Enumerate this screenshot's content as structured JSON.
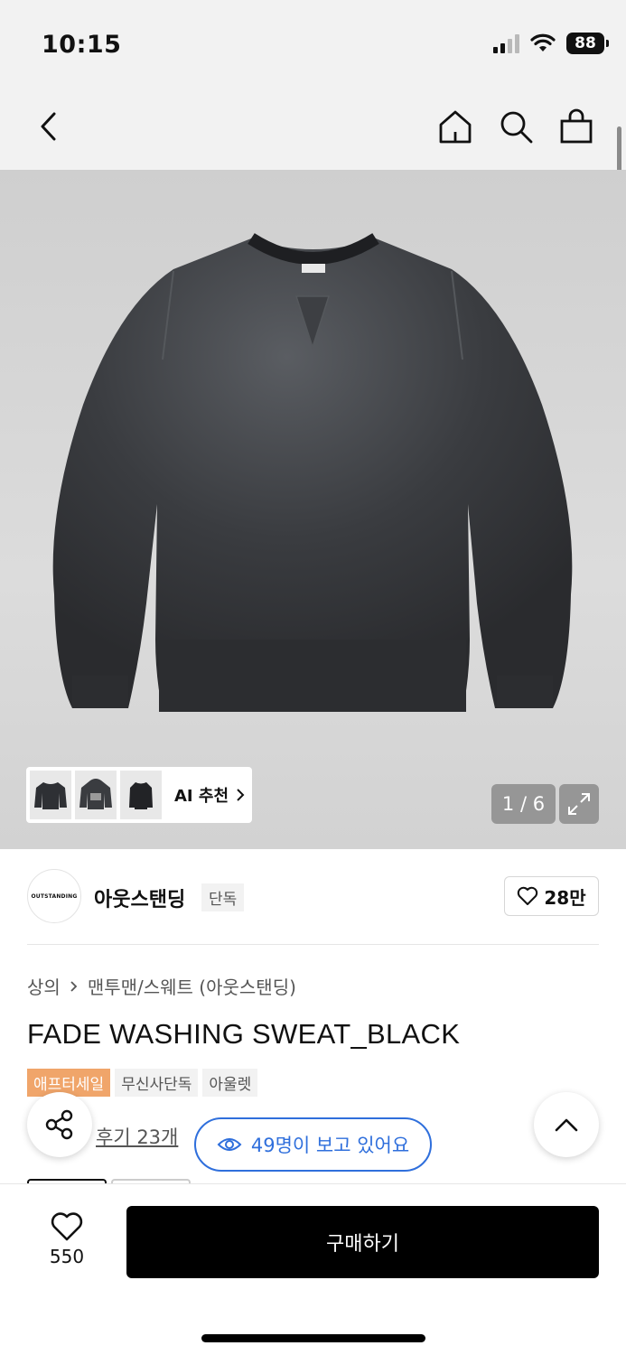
{
  "status": {
    "time": "10:15",
    "battery": "88"
  },
  "hero": {
    "page_counter": "1 / 6",
    "ai_recommend_label": "AI 추천"
  },
  "brand": {
    "logo_text": "OUTSTANDING",
    "name": "아웃스탠딩",
    "exclusive_tag": "단독",
    "likes": "28만"
  },
  "breadcrumb": {
    "category": "상의",
    "subcategory": "맨투맨/스웨트 (아웃스탠딩)"
  },
  "product": {
    "title": "FADE WASHING SWEAT_BLACK",
    "tags": [
      "애프터세일",
      "무신사단독",
      "아울렛"
    ]
  },
  "reviews": {
    "label": "후기 23개"
  },
  "viewers": {
    "label": "49명이 보고 있어요"
  },
  "bottom": {
    "wish_count": "550",
    "buy_label": "구매하기"
  },
  "colors": {
    "accent_blue": "#2f6fdc",
    "sale_tag": "#f0a56a",
    "buy_button": "#000000"
  }
}
